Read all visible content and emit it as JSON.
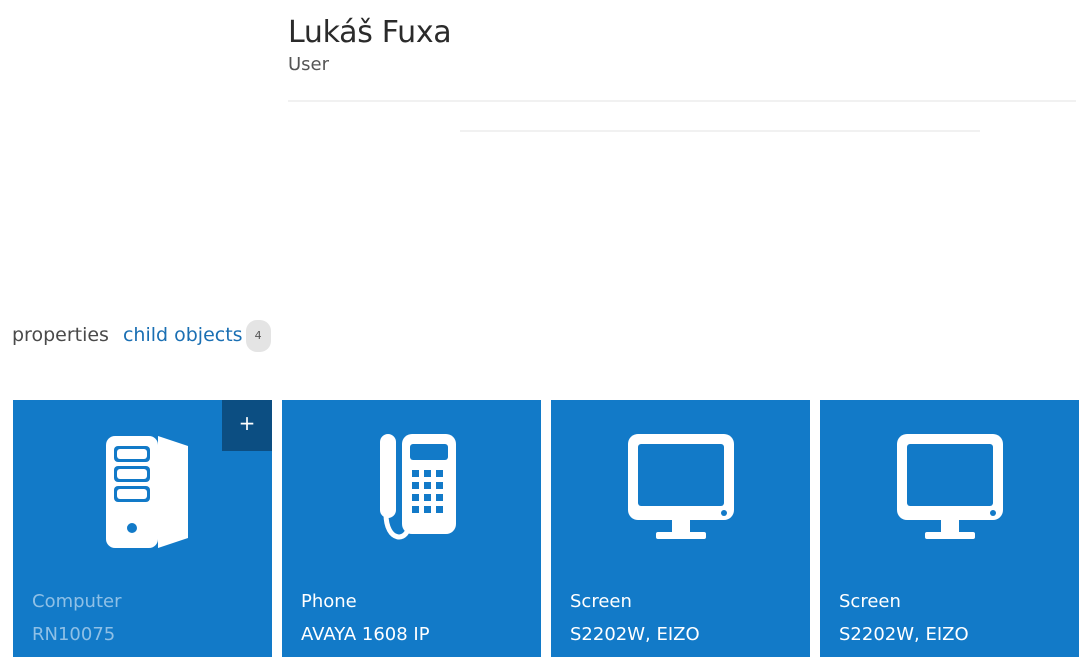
{
  "user": {
    "name": "Lukáš Fuxa",
    "role": "User"
  },
  "tabs": {
    "properties_label": "properties",
    "child_objects_label": "child objects",
    "child_count": "4"
  },
  "tiles": [
    {
      "type": "Computer",
      "model": "RN10075",
      "icon": "computer-tower-icon",
      "add_label": "+"
    },
    {
      "type": "Phone",
      "model": "AVAYA 1608 IP",
      "icon": "desk-phone-icon"
    },
    {
      "type": "Screen",
      "model": "S2202W, EIZO",
      "icon": "monitor-icon"
    },
    {
      "type": "Screen",
      "model": "S2202W, EIZO",
      "icon": "monitor-icon"
    }
  ],
  "colors": {
    "tile_blue": "#127ac8",
    "add_button_dark": "#0c4e82",
    "link_blue": "#1a6fb3",
    "badge_gray": "#e4e4e4"
  }
}
